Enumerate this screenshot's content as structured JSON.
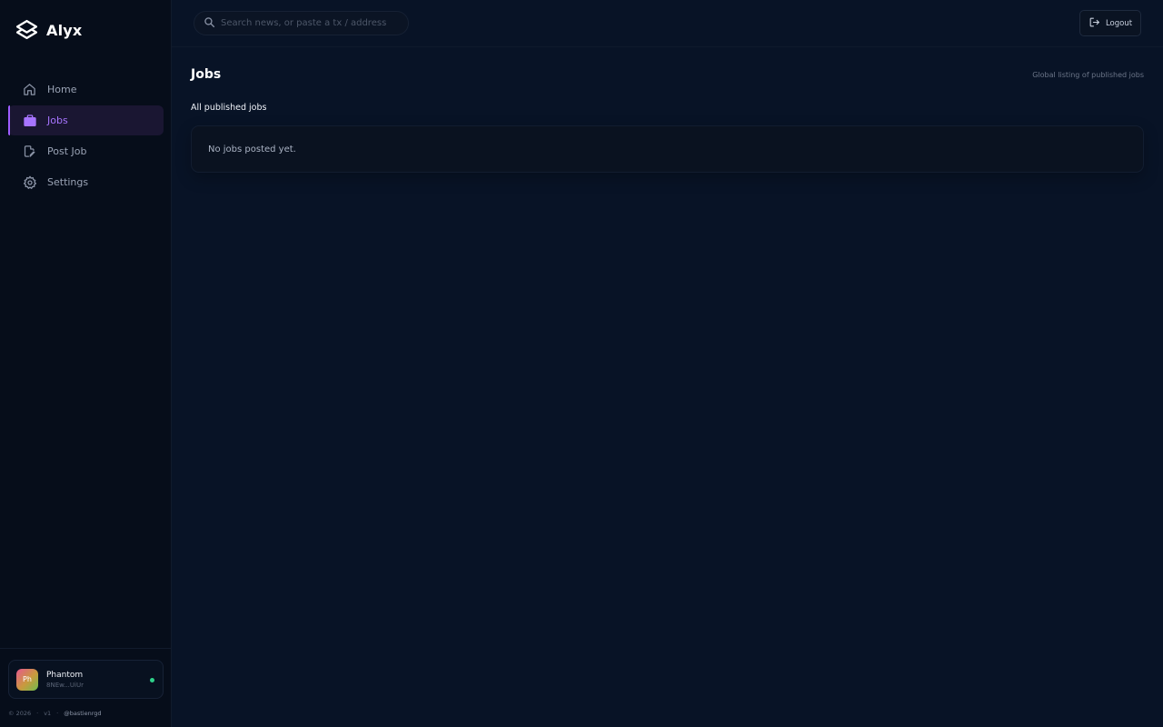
{
  "brand": {
    "name": "Alyx"
  },
  "sidebar": {
    "items": [
      {
        "label": "Home",
        "icon": "home-icon",
        "active": false
      },
      {
        "label": "Jobs",
        "icon": "briefcase-icon",
        "active": true
      },
      {
        "label": "Post Job",
        "icon": "document-edit-icon",
        "active": false
      },
      {
        "label": "Settings",
        "icon": "gear-icon",
        "active": false
      }
    ],
    "wallet": {
      "avatar_initials": "Ph",
      "name": "Phantom",
      "address": "8NEw...UiUr",
      "status": "connected"
    },
    "footer": {
      "copyright": "© 2026",
      "sep1": "·",
      "version": "v1",
      "sep2": "·",
      "handle": "@bastienrgd"
    }
  },
  "topbar": {
    "search": {
      "placeholder": "Search news, or paste a tx / address",
      "value": ""
    },
    "logout_label": "Logout"
  },
  "main": {
    "title": "Jobs",
    "subtitle": "Global listing of published jobs",
    "section_title": "All published jobs",
    "empty_message": "No jobs posted yet."
  },
  "colors": {
    "background": "#081326",
    "sidebar": "#060d1a",
    "accent": "#a774ff",
    "status_online": "#2fd18a"
  }
}
